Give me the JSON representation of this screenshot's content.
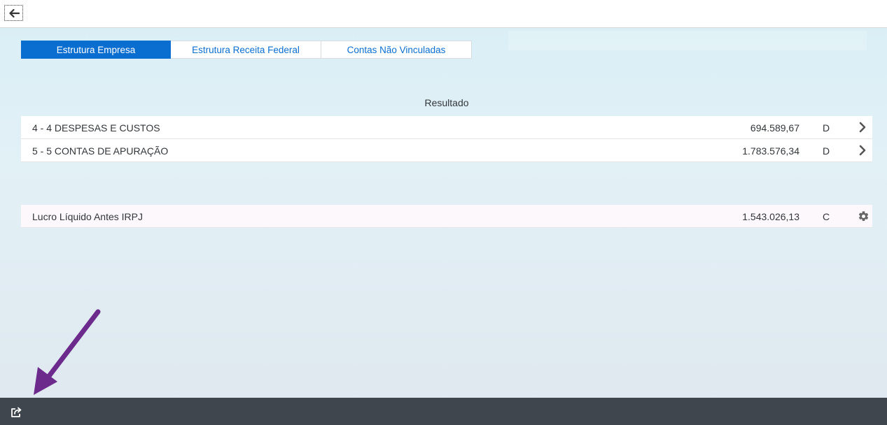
{
  "header": {
    "back_icon": "arrow-left-icon"
  },
  "tabs": [
    {
      "label": "Estrutura Empresa",
      "active": true
    },
    {
      "label": "Estrutura Receita Federal",
      "active": false
    },
    {
      "label": "Contas Não Vinculadas",
      "active": false
    }
  ],
  "section": {
    "title": "Resultado"
  },
  "results": [
    {
      "label": "4 - 4 DESPESAS E CUSTOS",
      "value": "694.589,67",
      "flag": "D",
      "icon": "chevron-right-icon"
    },
    {
      "label": "5 - 5 CONTAS DE APURAÇÃO",
      "value": "1.783.576,34",
      "flag": "D",
      "icon": "chevron-right-icon"
    }
  ],
  "summary": {
    "label": "Lucro Líquido Antes IRPJ",
    "value": "1.543.026,13",
    "flag": "C",
    "icon": "gear-icon"
  },
  "footer": {
    "share_icon": "share-icon"
  },
  "colors": {
    "accent": "#0a6ed1",
    "footer_bg": "#3f464d",
    "annotation_arrow": "#6b2a8c"
  }
}
